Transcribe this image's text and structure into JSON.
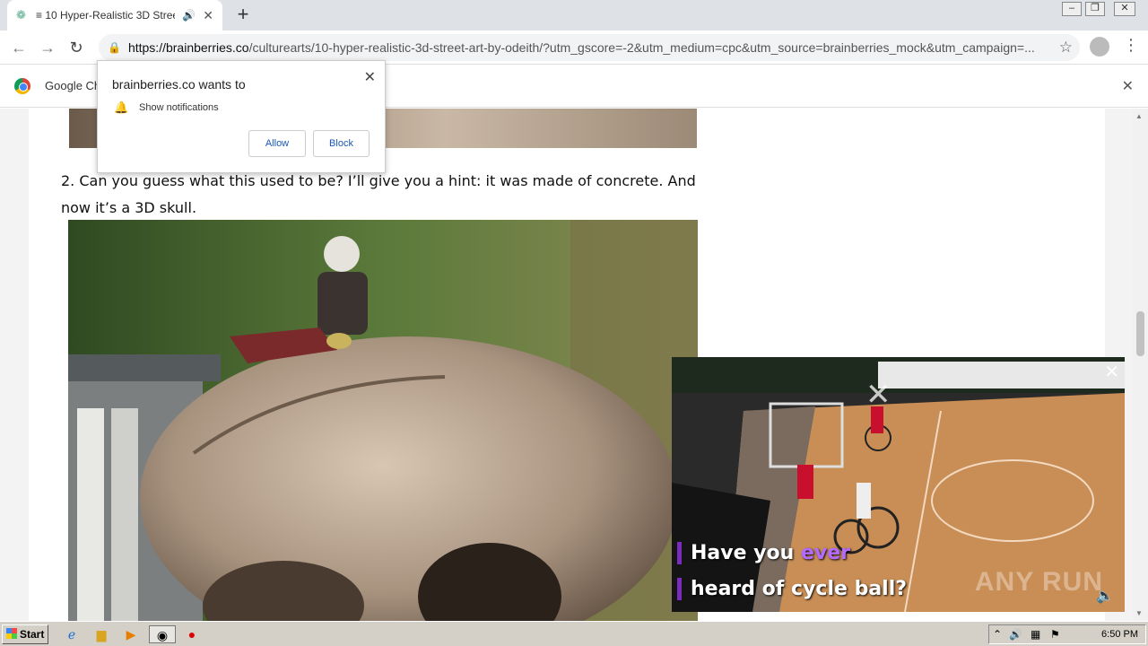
{
  "browser": {
    "tab_title": "≡ 10 Hyper-Realistic 3D Street",
    "url_host": "https://brainberries.co",
    "url_path": "/culturearts/10-hyper-realistic-3d-street-art-by-odeith/?utm_gscore=-2&utm_medium=cpc&utm_source=brainberries_mock&utm_campaign=...",
    "infobar_text": "Google Ch"
  },
  "notification": {
    "heading": "brainberries.co wants to",
    "permission": "Show notifications",
    "allow_label": "Allow",
    "block_label": "Block"
  },
  "article": {
    "paragraph": "2. Can you guess what this used to be? I’ll give you a hint: it was made of concrete. And now it’s a 3D skull."
  },
  "video_ad": {
    "caption_line1_a": "Have you ",
    "caption_line1_b": "ever",
    "caption_line2": "heard of cycle ball?",
    "watermark": "ANY RUN"
  },
  "taskbar": {
    "start_label": "Start",
    "clock": "6:50 PM"
  },
  "icons": [
    "audio-icon",
    "lock-icon",
    "star-icon",
    "bell-icon",
    "close-icon",
    "volume-icon"
  ]
}
